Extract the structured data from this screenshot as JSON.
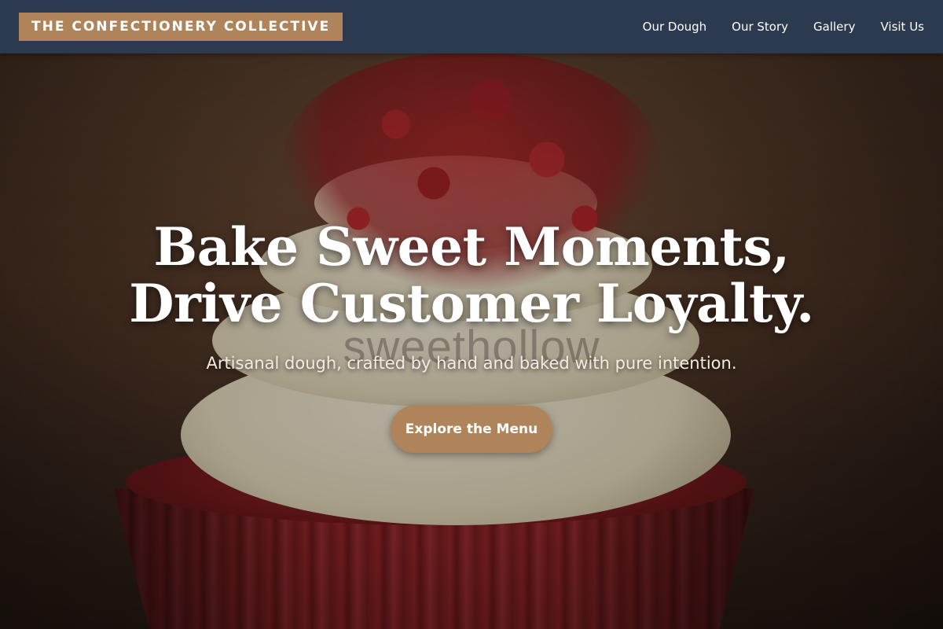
{
  "header": {
    "logo_text": "THE CONFECTIONERY COLLECTIVE",
    "nav": [
      {
        "label": "Our Dough"
      },
      {
        "label": "Our Story"
      },
      {
        "label": "Gallery"
      },
      {
        "label": "Visit Us"
      }
    ]
  },
  "hero": {
    "headline_line1": "Bake Sweet Moments,",
    "headline_line2": "Drive Customer Loyalty.",
    "subheadline": "Artisanal dough, crafted by hand and baked with pure intention.",
    "cta_label": "Explore the Menu",
    "background_image": "red-velvet-cupcake-photo",
    "watermark_text": "sweethollow"
  },
  "colors": {
    "header_bg": "#2c3a4f",
    "accent": "#b0845a",
    "text_light": "#ffffff"
  }
}
